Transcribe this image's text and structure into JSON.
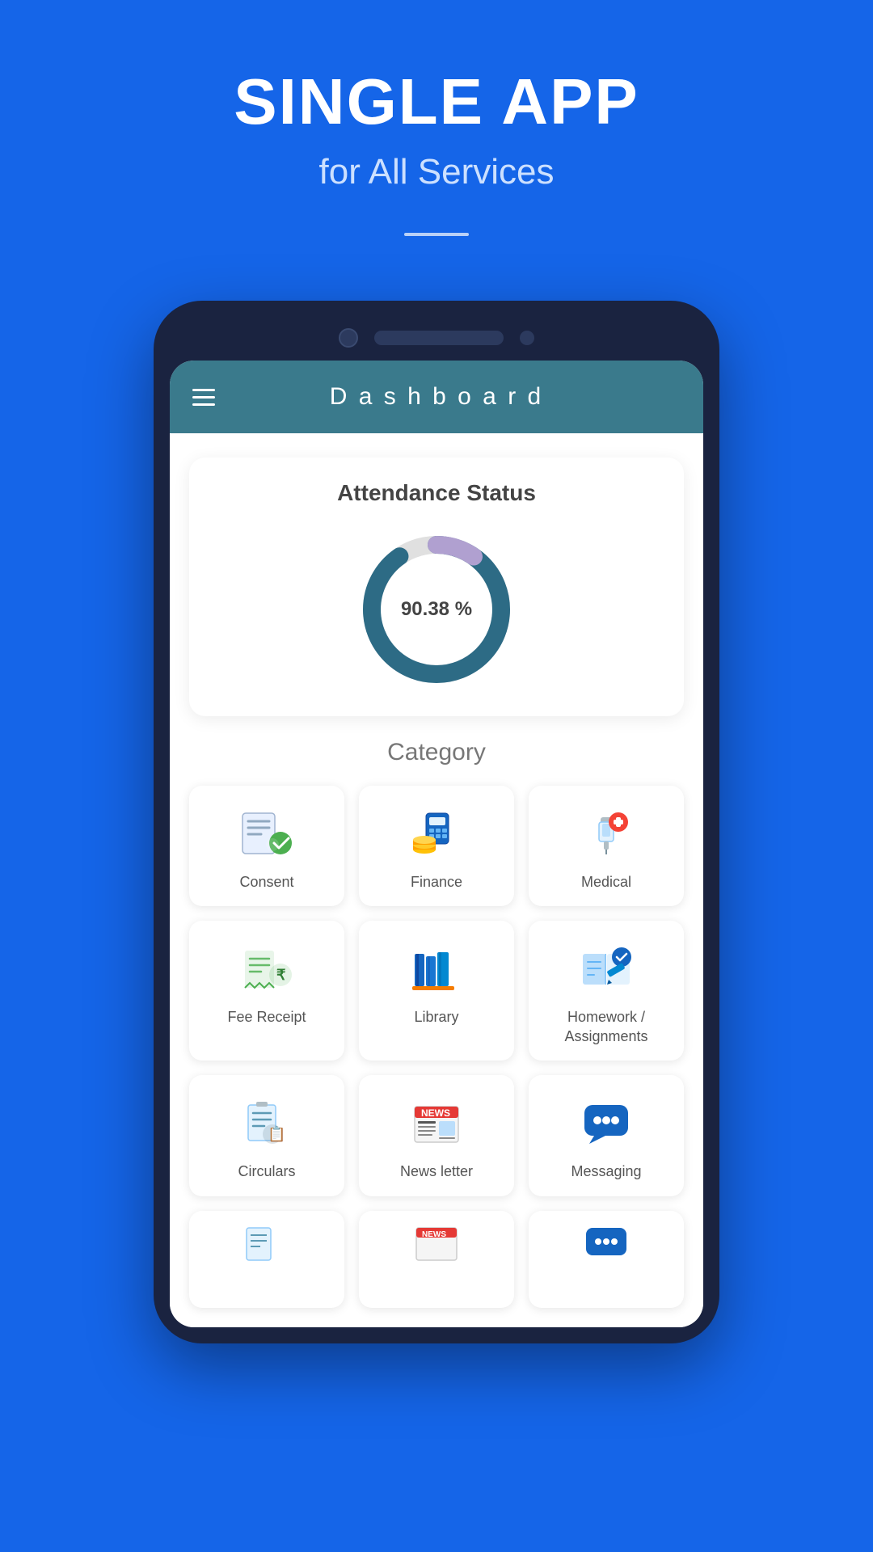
{
  "hero": {
    "title": "SINGLE APP",
    "subtitle": "for All Services"
  },
  "dashboard": {
    "title": "D a s h b o a r d",
    "attendance": {
      "section_title": "Attendance Status",
      "percentage": "90.38 %",
      "value": 90.38
    },
    "category": {
      "section_title": "Category",
      "items": [
        {
          "id": "consent",
          "label": "Consent",
          "icon": "consent-icon"
        },
        {
          "id": "finance",
          "label": "Finance",
          "icon": "finance-icon"
        },
        {
          "id": "medical",
          "label": "Medical",
          "icon": "medical-icon"
        },
        {
          "id": "fee-receipt",
          "label": "Fee Receipt",
          "icon": "fee-receipt-icon"
        },
        {
          "id": "library",
          "label": "Library",
          "icon": "library-icon"
        },
        {
          "id": "homework",
          "label": "Homework / Assignments",
          "icon": "homework-icon"
        },
        {
          "id": "circulars",
          "label": "Circulars",
          "icon": "circulars-icon"
        },
        {
          "id": "newsletter",
          "label": "News letter",
          "icon": "newsletter-icon"
        },
        {
          "id": "messaging",
          "label": "Messaging",
          "icon": "messaging-icon"
        }
      ]
    }
  }
}
